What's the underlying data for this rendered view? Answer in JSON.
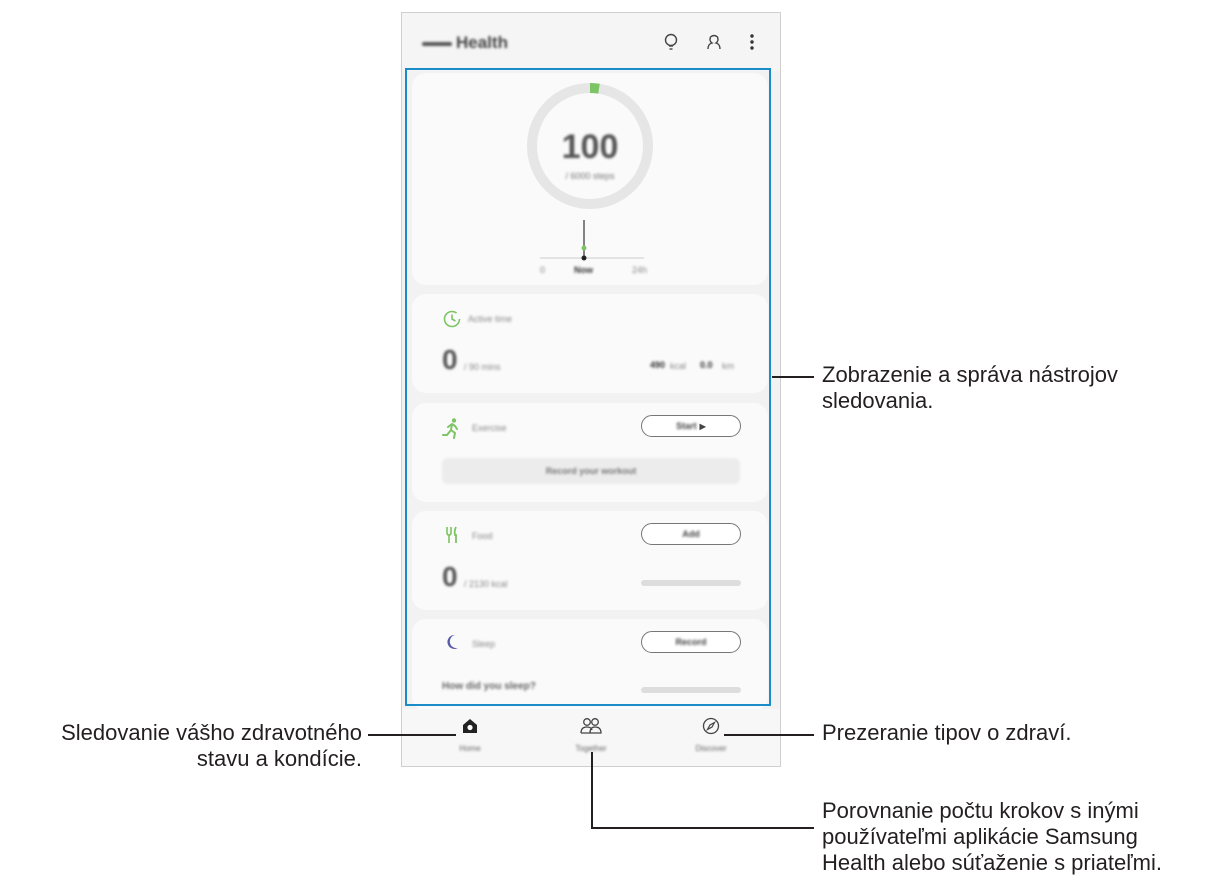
{
  "app": {
    "title": "Health",
    "toolbar_icons": [
      "lightbulb-icon",
      "person-icon",
      "more-vert-icon"
    ]
  },
  "steps": {
    "count": "100",
    "goal": "/ 6000 steps",
    "timeline": [
      "0",
      "Now",
      "24h"
    ]
  },
  "active_time": {
    "label": "Active time",
    "value": "0",
    "goal": "/ 90 mins",
    "stat1_value": "490",
    "stat1_unit": "kcal",
    "stat2_value": "0.0",
    "stat2_unit": "km"
  },
  "exercise": {
    "label": "Exercise",
    "start_label": "Start",
    "record_label": "Record your workout"
  },
  "food": {
    "label": "Food",
    "add_label": "Add",
    "value": "0",
    "goal": "/ 2130 kcal"
  },
  "sleep": {
    "label": "Sleep",
    "record_label": "Record",
    "question": "How did you sleep?"
  },
  "nav": {
    "home": "Home",
    "together": "Together",
    "discover": "Discover"
  },
  "callouts": {
    "tracking": [
      "Zobrazenie a správa nástrojov",
      "sledovania."
    ],
    "home": [
      "Sledovanie vášho zdravotného",
      "stavu a kondície."
    ],
    "discover": [
      "Prezeranie tipov o zdraví."
    ],
    "together": [
      "Porovnanie počtu krokov s inými",
      "používateľmi aplikácie Samsung",
      "Health alebo súťaženie s priateľmi."
    ]
  },
  "colors": {
    "highlight": "#1a8cc8",
    "green": "#7dc464",
    "purple": "#5a5aa6"
  }
}
